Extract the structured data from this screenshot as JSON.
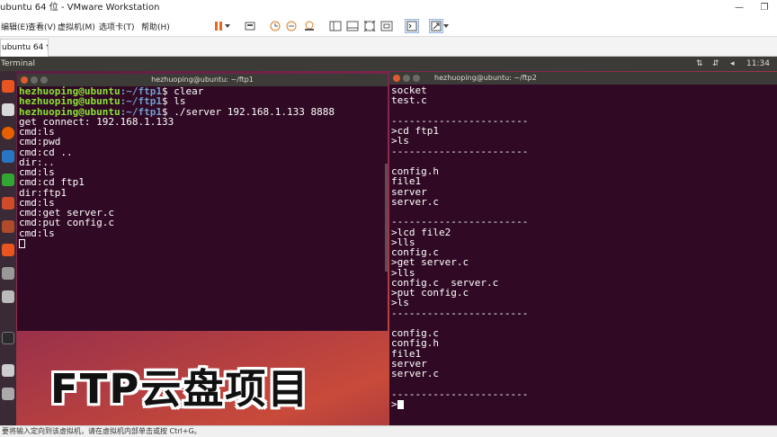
{
  "window": {
    "title": "ubuntu 64 位 - VMware Workstation"
  },
  "menu": [
    "编辑(E)",
    "查看(V)",
    "虚拟机(M)",
    "选项卡(T)",
    "帮助(H)"
  ],
  "vm_tab": {
    "label": "ubuntu 64 位"
  },
  "ubuntu": {
    "app_name": "Terminal",
    "clock": "11:34 PM"
  },
  "term1": {
    "title": "hezhuoping@ubuntu: ~/ftp1",
    "lines": [
      {
        "prompt_user": "hezhuoping@ubuntu",
        "prompt_path": ":~/ftp1",
        "cmd": "$ clear"
      },
      {
        "prompt_user": "hezhuoping@ubuntu",
        "prompt_path": ":~/ftp1",
        "cmd": "$ ls"
      },
      {
        "prompt_user": "hezhuoping@ubuntu",
        "prompt_path": ":~/ftp1",
        "cmd": "$ ./server 192.168.1.133 8888"
      },
      {
        "text": "get connect: 192.168.1.133"
      },
      {
        "text": "cmd:ls"
      },
      {
        "text": "cmd:pwd"
      },
      {
        "text": "cmd:cd .."
      },
      {
        "text": "dir:.."
      },
      {
        "text": "cmd:ls"
      },
      {
        "text": "cmd:cd ftp1"
      },
      {
        "text": "dir:ftp1"
      },
      {
        "text": "cmd:ls"
      },
      {
        "text": "cmd:get server.c"
      },
      {
        "text": "cmd:put config.c"
      },
      {
        "text": "cmd:ls"
      }
    ]
  },
  "term2": {
    "title": "hezhuoping@ubuntu: ~/ftp2",
    "lines": [
      "socket",
      "test.c",
      "",
      "-----------------------",
      ">cd ftp1",
      ">ls",
      "-----------------------",
      "",
      "config.h",
      "file1",
      "server",
      "server.c",
      "",
      "-----------------------",
      ">lcd file2",
      ">lls",
      "config.c",
      ">get server.c",
      ">lls",
      "config.c  server.c",
      ">put config.c",
      ">ls",
      "-----------------------",
      "",
      "config.c",
      "config.h",
      "file1",
      "server",
      "server.c",
      "",
      "-----------------------",
      ">"
    ]
  },
  "caption": "FTP云盘项目",
  "statusbar": {
    "text": "要将输入定向到该虚拟机，请在虚拟机内部单击或按 Ctrl+G。"
  }
}
